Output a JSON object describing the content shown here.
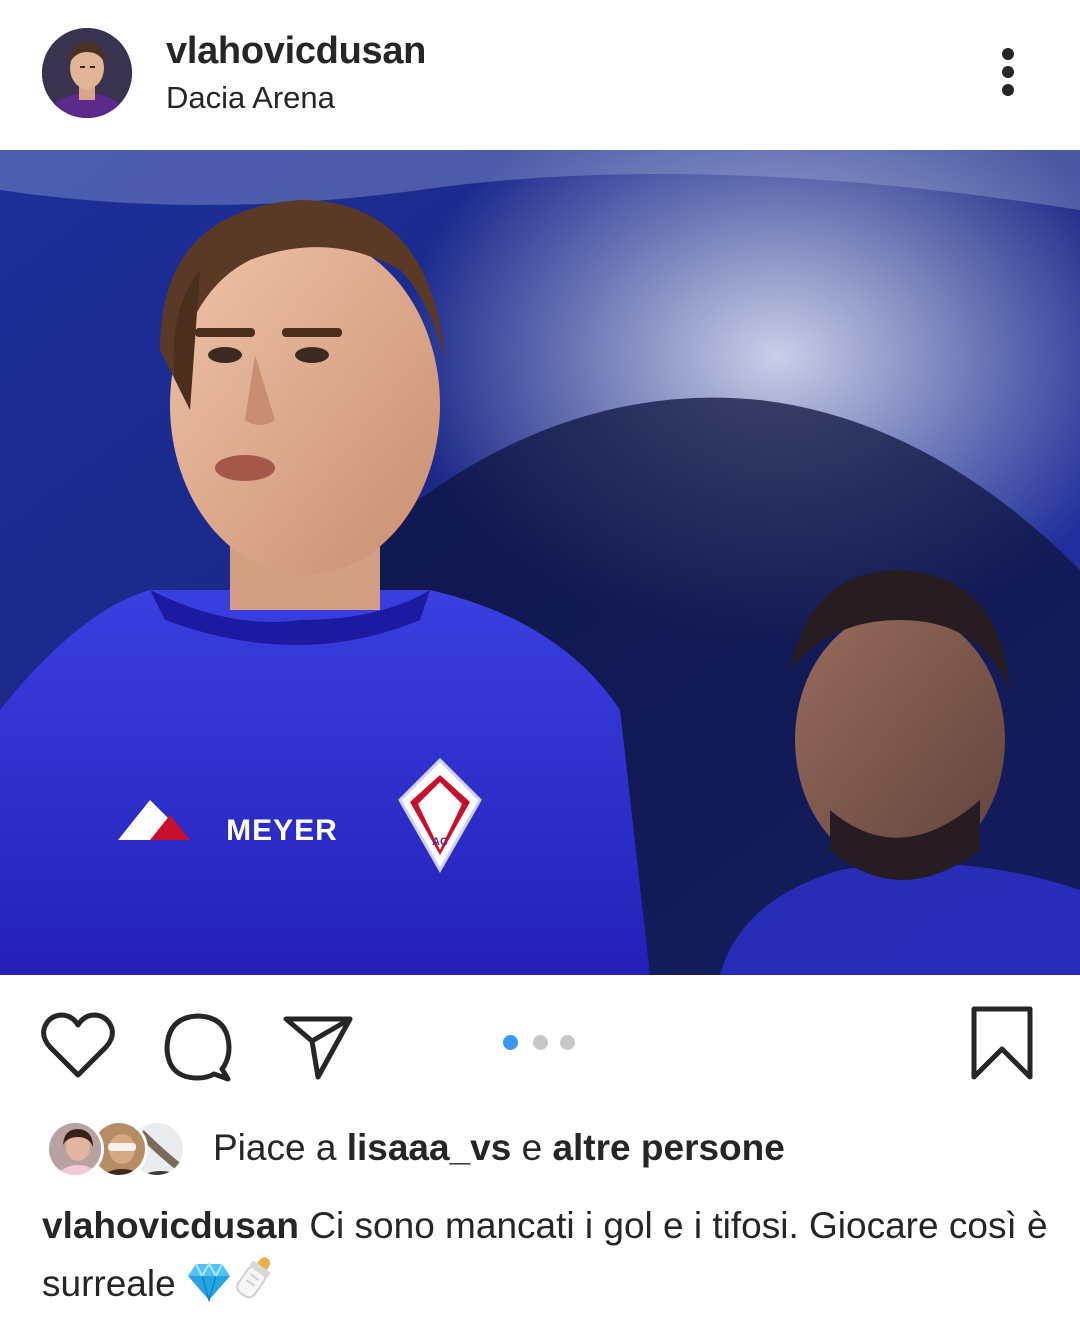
{
  "post": {
    "username": "vlahovicdusan",
    "location": "Dacia Arena"
  },
  "photo": {
    "shirt_sponsor": "MEYER",
    "crest_letters": "AC",
    "colors": {
      "kit": "#2f2fd0",
      "background": "#1b2b8e",
      "accent": "#c8102e"
    }
  },
  "actions": {
    "icons": [
      "heart-icon",
      "comment-icon",
      "share-icon",
      "bookmark-icon"
    ],
    "carousel": {
      "count": 3,
      "active": 1,
      "active_color": "#3897f0"
    }
  },
  "likes": {
    "prefix": "Piace a",
    "user": "lisaaa_vs",
    "conjunction": "e",
    "others": "altre persone"
  },
  "caption": {
    "username": "vlahovicdusan",
    "text": "Ci sono mancati i gol e i tifosi. Giocare così è surreale",
    "emojis": [
      "gem-icon",
      "baby-bottle-icon"
    ]
  }
}
